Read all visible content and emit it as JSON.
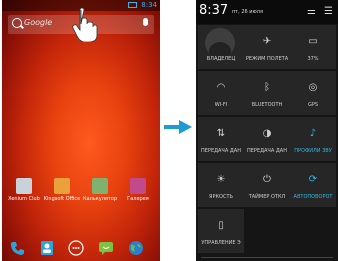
{
  "left_screen": {
    "status_time": "8:34",
    "search_text": "Google",
    "apps": [
      {
        "label": "Xenium Club",
        "color": "#c8d2d8"
      },
      {
        "label": "Kingsoft Office",
        "color": "#e9a23b"
      },
      {
        "label": "Калькулятор",
        "color": "#7fb26f"
      },
      {
        "label": "Галерея",
        "color": "#c24a8a"
      }
    ]
  },
  "right_screen": {
    "time": "8:37",
    "date": "пт, 26 июля",
    "tiles": [
      {
        "label": "ВЛАДЕЛЕЦ",
        "icon": "",
        "on": false
      },
      {
        "label": "РЕЖИМ ПОЛЕТА",
        "icon": "✈",
        "on": false
      },
      {
        "label": "37%",
        "icon": "▭",
        "on": false
      },
      {
        "label": "WI-FI",
        "icon": "◠",
        "on": false
      },
      {
        "label": "BLUETOOTH",
        "icon": "ᛒ",
        "on": false
      },
      {
        "label": "GPS",
        "icon": "◎",
        "on": false
      },
      {
        "label": "ПЕРЕДАЧА ДАН",
        "icon": "⇅",
        "on": false
      },
      {
        "label": "ПЕРЕДАЧА ДАН",
        "icon": "◑",
        "on": false
      },
      {
        "label": "ПРОФИЛИ ЗВУ",
        "icon": "♪",
        "on": true
      },
      {
        "label": "ЯРКОСТЬ",
        "icon": "☀",
        "on": false
      },
      {
        "label": "ТАЙМЕР ОТКЛ",
        "icon": "⏻",
        "on": false
      },
      {
        "label": "АВТОПОВОРОТ",
        "icon": "⟳",
        "on": true
      },
      {
        "label": "УПРАВЛЕНИЕ Э",
        "icon": "▯",
        "on": false
      }
    ]
  }
}
